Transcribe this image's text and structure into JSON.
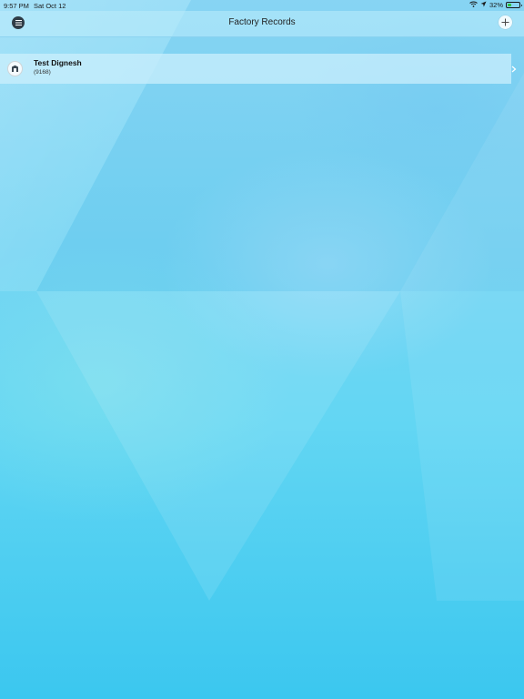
{
  "status_bar": {
    "time": "9:57 PM",
    "date": "Sat Oct 12",
    "battery_percent": "32%",
    "battery_level": 0.32
  },
  "nav": {
    "title": "Factory Records",
    "menu_icon": "menu-icon",
    "add_icon": "plus-icon"
  },
  "records": [
    {
      "name": "Test Dignesh",
      "code": "(9168)",
      "icon": "factory-icon"
    }
  ],
  "colors": {
    "menu_button": "#2f3c47",
    "battery_fill": "#2bbf3a"
  }
}
